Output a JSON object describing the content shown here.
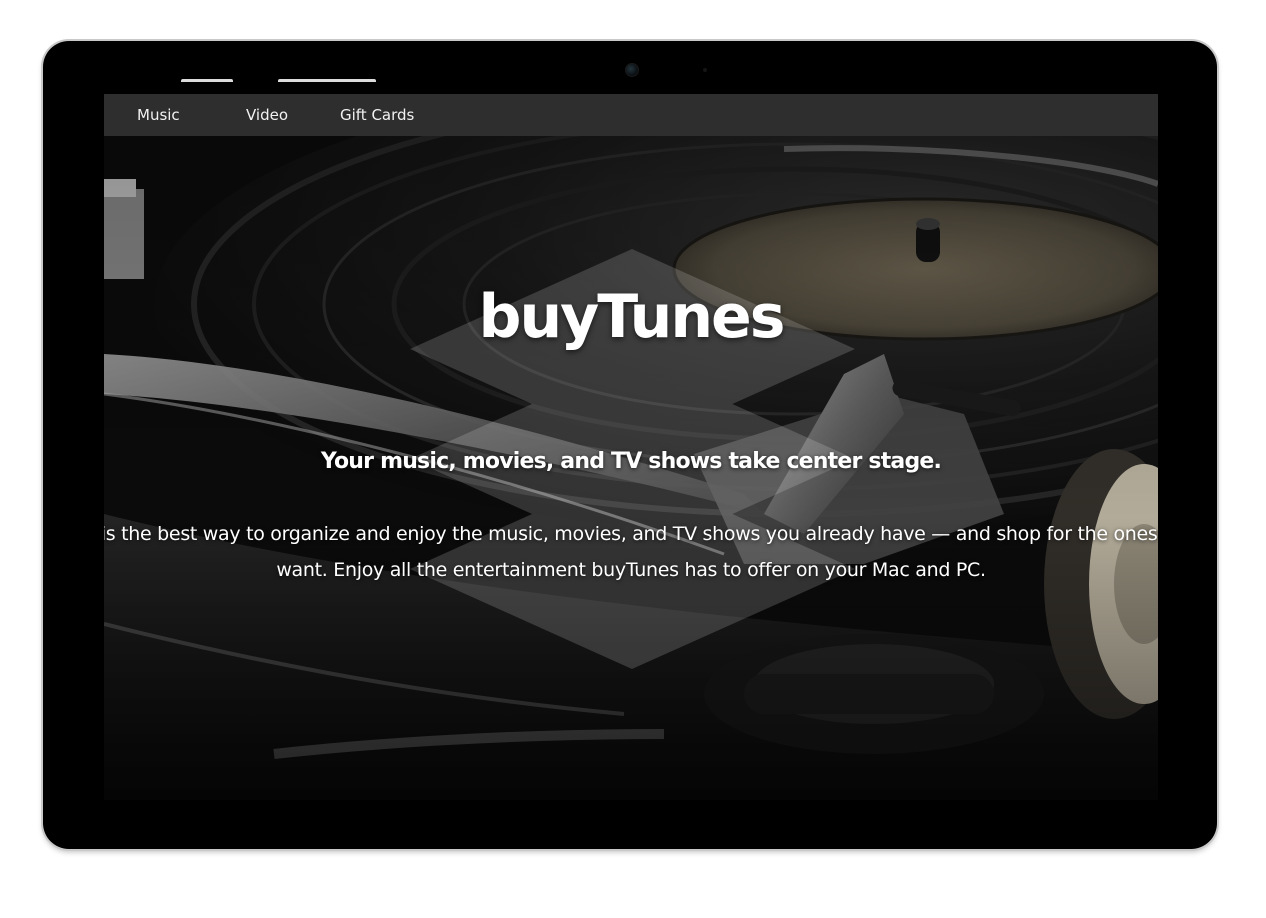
{
  "nav": {
    "items": [
      {
        "label": "Music"
      },
      {
        "label": "Video"
      },
      {
        "label": "Gift Cards"
      }
    ]
  },
  "hero": {
    "title": "buyTunes",
    "subtitle": "Your music, movies, and TV shows take center stage.",
    "body_line_1": "buyTunes is the best way to organize and enjoy the music, movies, and TV shows you already have — and shop for the ones you want.",
    "body_line_2": "want. Enjoy all the entertainment buyTunes has to offer on your Mac and PC.",
    "background_image": "record-player-photo"
  },
  "device": {
    "camera_icon": "camera-icon",
    "frame_color": "#000000",
    "bezel_edge_color": "#c9c9c9"
  },
  "colors": {
    "navbar_bg": "#2e2e2e",
    "nav_text": "#f2f2f2",
    "hero_text": "#ffffff"
  }
}
